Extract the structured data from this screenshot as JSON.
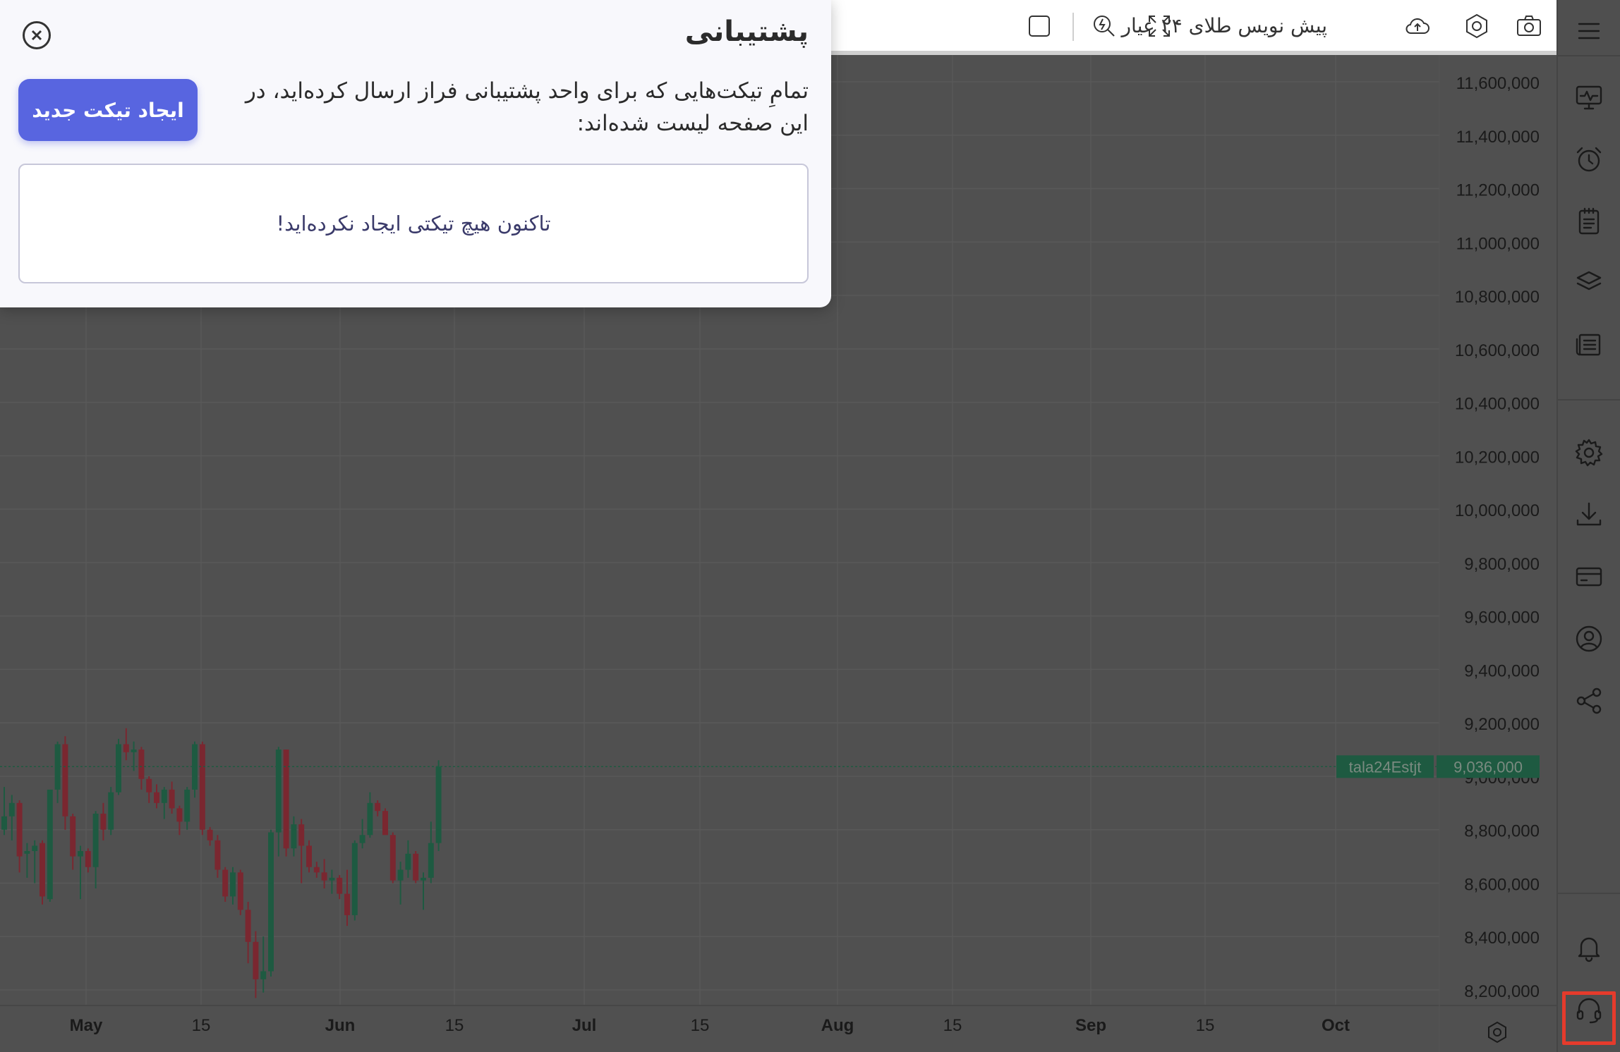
{
  "toolbar": {
    "symbol_label": "پیش نویس طلای ۲۴ عیار",
    "icons": [
      "menu-icon",
      "camera-icon",
      "hexagon-settings-icon",
      "cloud-upload-icon",
      "fullscreen-icon",
      "search-lightning-icon",
      "square-icon"
    ]
  },
  "modal": {
    "title": "پشتیبانی",
    "description": "تمامِ تیکت‌هایی که برای واحد پشتیبانی فراز ارسال کرده‌اید، در این صفحه لیست شده‌اند:",
    "new_ticket_label": "ایجاد تیکت جدید",
    "empty_message": "تاکنون هیچ تیکتی ایجاد نکرده‌اید!"
  },
  "sidebar": {
    "icons": [
      "monitor-pulse-icon",
      "alarm-clock-icon",
      "clipboard-icon",
      "layers-icon",
      "news-list-icon",
      "gear-icon",
      "download-icon",
      "credit-card-icon",
      "user-circle-icon",
      "share-icon",
      "bell-icon",
      "headset-icon"
    ]
  },
  "chart_data": {
    "type": "candlestick",
    "y_ticks": [
      "11,600,000",
      "11,400,000",
      "11,200,000",
      "11,000,000",
      "10,800,000",
      "10,600,000",
      "10,400,000",
      "10,200,000",
      "10,000,000",
      "9,800,000",
      "9,600,000",
      "9,400,000",
      "9,200,000",
      "9,000,000",
      "8,800,000",
      "8,600,000",
      "8,400,000",
      "8,200,000"
    ],
    "x_ticks": [
      "May",
      "15",
      "Jun",
      "15",
      "Jul",
      "15",
      "Aug",
      "15",
      "Sep",
      "15",
      "Oct"
    ],
    "ylim": [
      8150000,
      11700000
    ],
    "last_price_label": "9,036,000",
    "symbol_tag": "tala24Estjt",
    "last_price": 9036000,
    "up_color": "#1e5a41",
    "down_color": "#7a2730",
    "candles": [
      [
        8800000,
        8960000,
        8780000,
        8850000
      ],
      [
        8850000,
        8930000,
        8760000,
        8900000
      ],
      [
        8900000,
        8910000,
        8640000,
        8700000
      ],
      [
        8710000,
        8750000,
        8620000,
        8720000
      ],
      [
        8720000,
        8760000,
        8600000,
        8740000
      ],
      [
        8750000,
        8760000,
        8520000,
        8550000
      ],
      [
        8540000,
        8800000,
        8530000,
        8950000
      ],
      [
        8950000,
        9130000,
        8900000,
        9120000
      ],
      [
        9120000,
        9150000,
        8800000,
        8850000
      ],
      [
        8850000,
        8860000,
        8650000,
        8700000
      ],
      [
        8700000,
        8740000,
        8540000,
        8720000
      ],
      [
        8720000,
        8730000,
        8640000,
        8660000
      ],
      [
        8660000,
        8870000,
        8580000,
        8860000
      ],
      [
        8860000,
        8900000,
        8760000,
        8800000
      ],
      [
        8800000,
        8960000,
        8780000,
        8940000
      ],
      [
        8940000,
        9140000,
        8930000,
        9120000
      ],
      [
        9120000,
        9180000,
        9060000,
        9090000
      ],
      [
        9090000,
        9130000,
        9020000,
        9100000
      ],
      [
        9100000,
        9110000,
        8950000,
        8990000
      ],
      [
        8990000,
        9000000,
        8900000,
        8940000
      ],
      [
        8940000,
        8970000,
        8880000,
        8900000
      ],
      [
        8900000,
        8960000,
        8840000,
        8950000
      ],
      [
        8950000,
        8980000,
        8860000,
        8880000
      ],
      [
        8880000,
        8890000,
        8780000,
        8830000
      ],
      [
        8830000,
        8960000,
        8800000,
        8950000
      ],
      [
        8950000,
        9130000,
        8920000,
        9120000
      ],
      [
        9120000,
        9130000,
        8780000,
        8800000
      ],
      [
        8800000,
        8810000,
        8740000,
        8760000
      ],
      [
        8760000,
        8780000,
        8620000,
        8650000
      ],
      [
        8650000,
        8660000,
        8530000,
        8550000
      ],
      [
        8550000,
        8660000,
        8520000,
        8640000
      ],
      [
        8640000,
        8650000,
        8480000,
        8500000
      ],
      [
        8500000,
        8530000,
        8300000,
        8380000
      ],
      [
        8380000,
        8420000,
        8170000,
        8240000
      ],
      [
        8240000,
        8400000,
        8190000,
        8270000
      ],
      [
        8270000,
        8800000,
        8250000,
        8790000
      ],
      [
        8790000,
        9110000,
        8700000,
        9100000
      ],
      [
        9100000,
        9100000,
        8700000,
        8730000
      ],
      [
        8730000,
        8850000,
        8700000,
        8820000
      ],
      [
        8820000,
        8840000,
        8600000,
        8740000
      ],
      [
        8740000,
        8760000,
        8640000,
        8660000
      ],
      [
        8660000,
        8680000,
        8620000,
        8640000
      ],
      [
        8640000,
        8690000,
        8580000,
        8610000
      ],
      [
        8610000,
        8650000,
        8560000,
        8620000
      ],
      [
        8620000,
        8630000,
        8540000,
        8560000
      ],
      [
        8560000,
        8650000,
        8440000,
        8480000
      ],
      [
        8480000,
        8760000,
        8460000,
        8750000
      ],
      [
        8750000,
        8840000,
        8730000,
        8780000
      ],
      [
        8780000,
        8940000,
        8770000,
        8900000
      ],
      [
        8900000,
        8910000,
        8850000,
        8870000
      ],
      [
        8870000,
        8880000,
        8800000,
        8780000
      ],
      [
        8780000,
        8790000,
        8600000,
        8610000
      ],
      [
        8610000,
        8680000,
        8520000,
        8650000
      ],
      [
        8650000,
        8760000,
        8620000,
        8710000
      ],
      [
        8710000,
        8720000,
        8600000,
        8610000
      ],
      [
        8610000,
        8640000,
        8500000,
        8620000
      ],
      [
        8620000,
        8830000,
        8600000,
        8750000
      ],
      [
        8750000,
        9060000,
        8720000,
        9036000
      ]
    ]
  }
}
